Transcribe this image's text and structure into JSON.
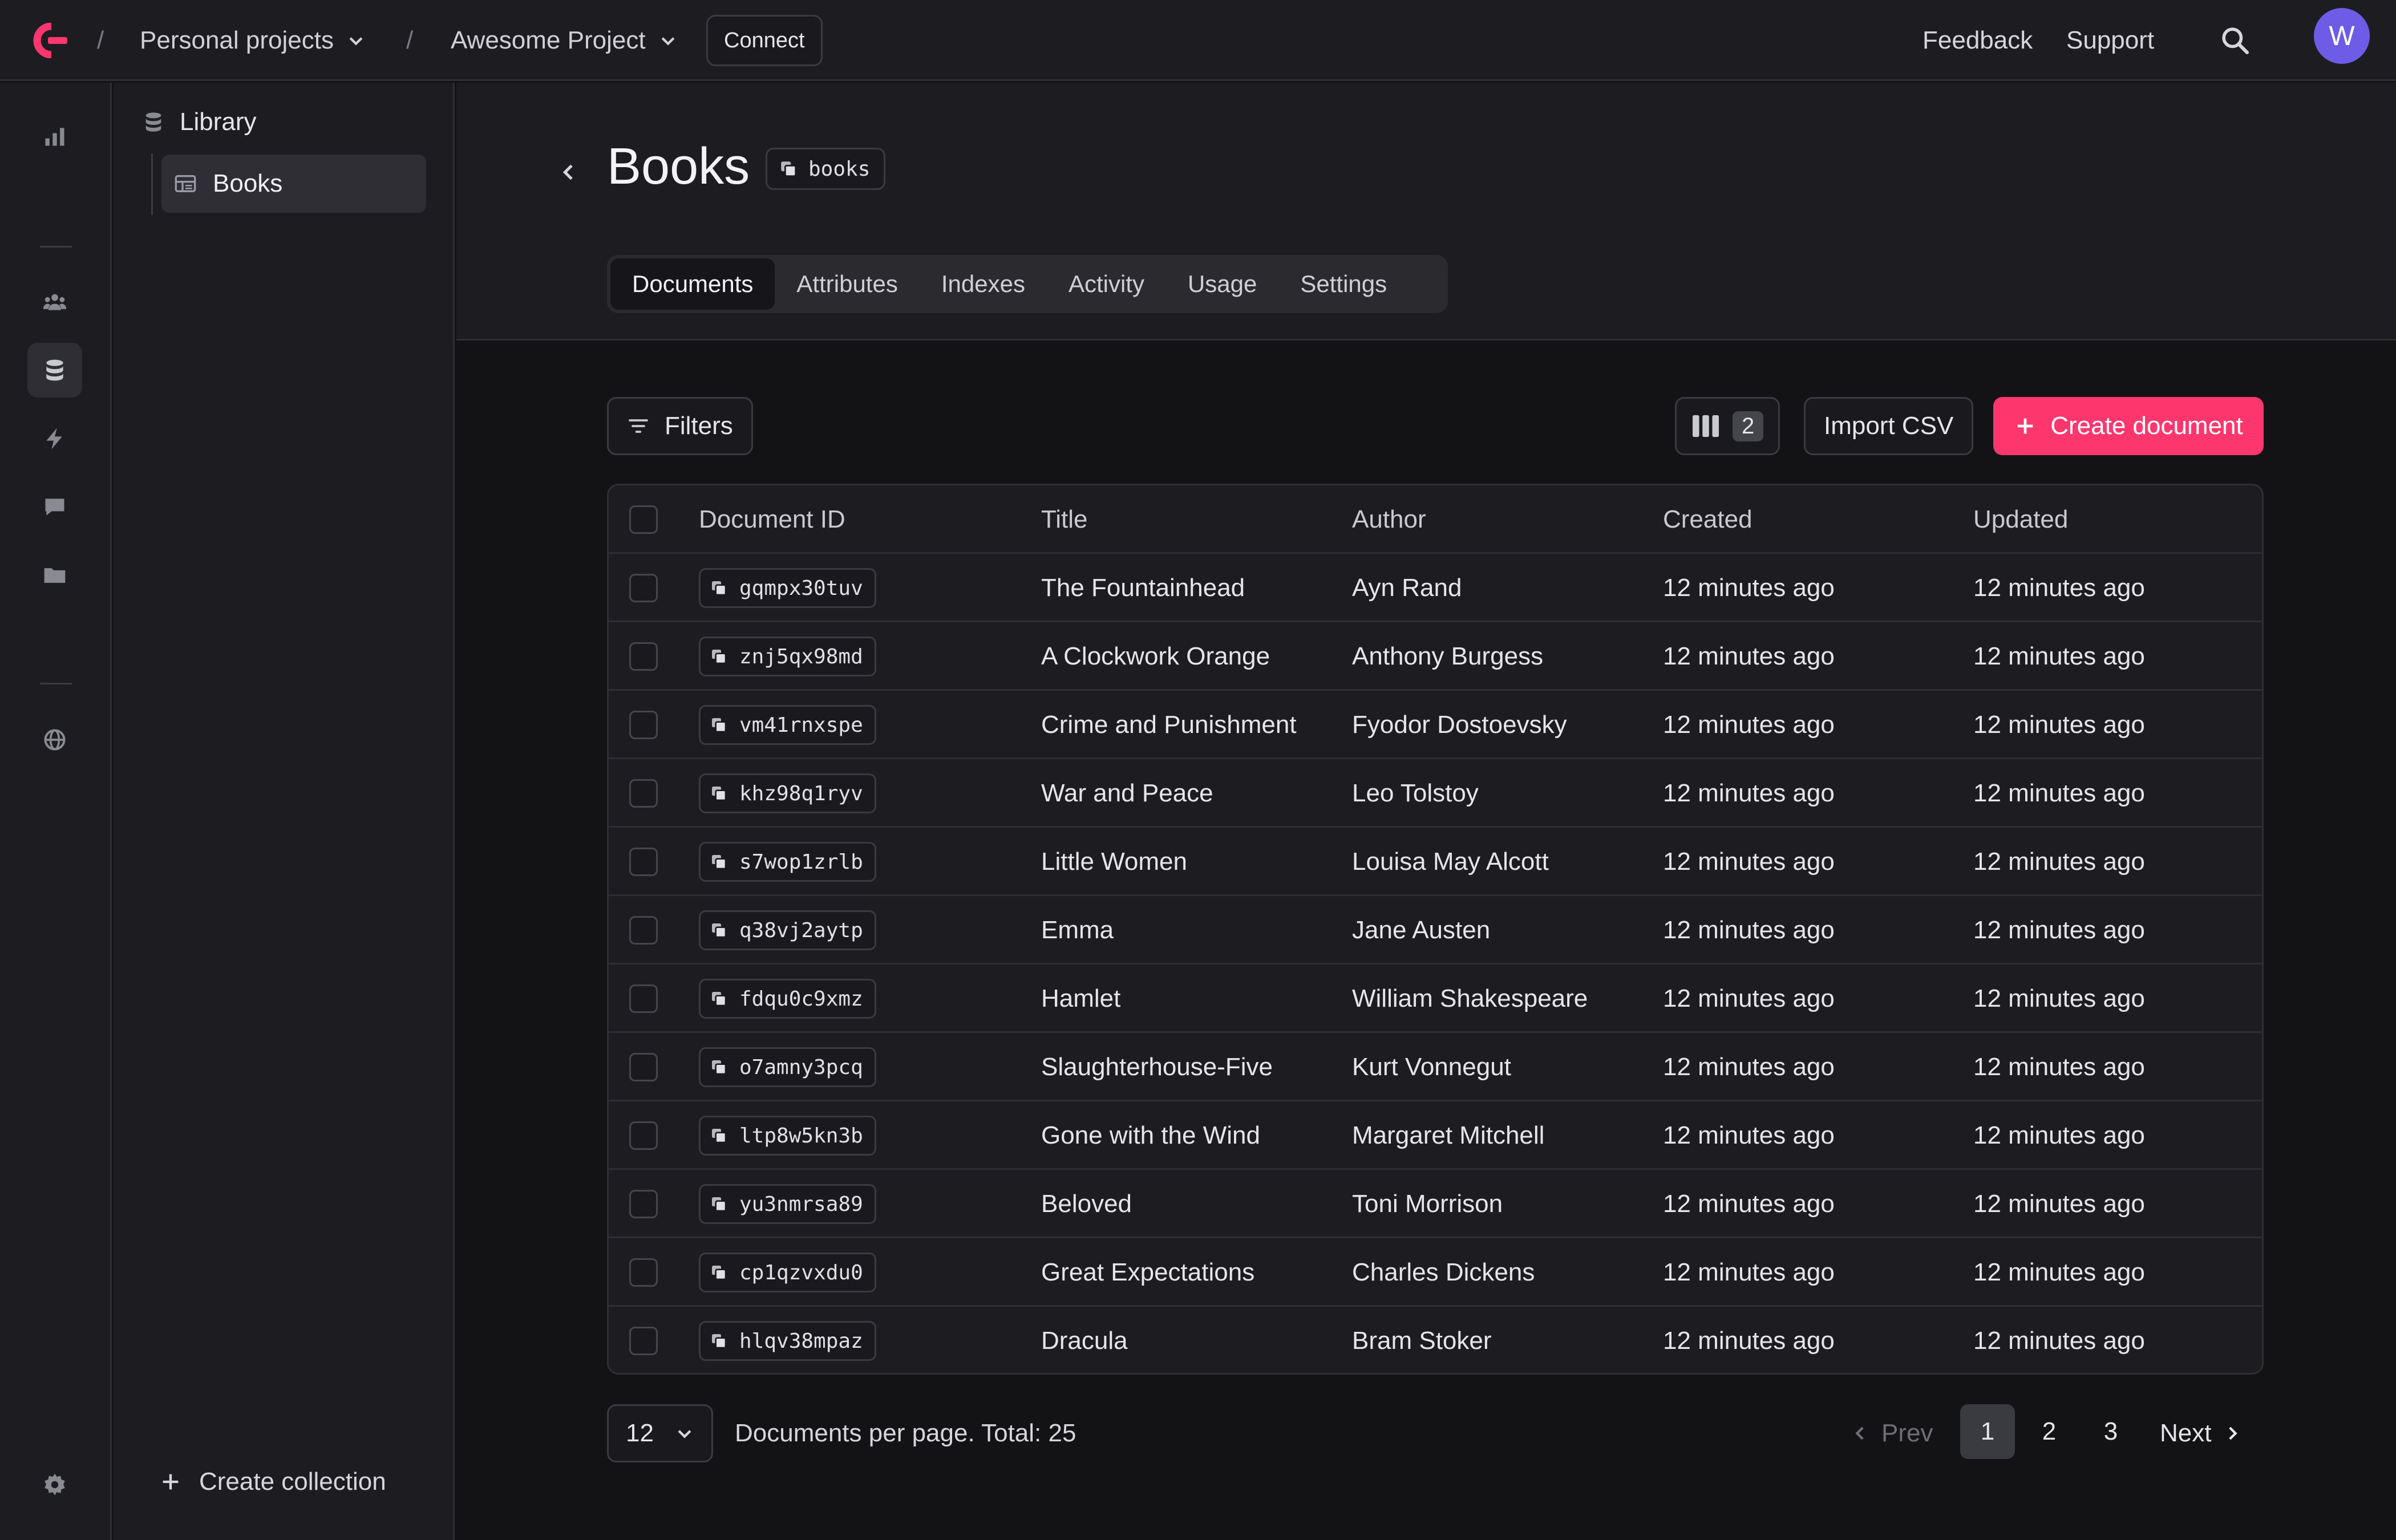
{
  "topbar": {
    "org": "Personal projects",
    "project": "Awesome Project",
    "connect_label": "Connect",
    "feedback_label": "Feedback",
    "support_label": "Support",
    "avatar_initial": "W",
    "breadcrumb_separator": "/"
  },
  "rail": {
    "icons": [
      "bar-chart-icon",
      "users-icon",
      "database-icon",
      "bolt-icon",
      "message-icon",
      "folder-icon",
      "globe-icon",
      "gear-icon"
    ],
    "active": "database-icon"
  },
  "sidebar": {
    "database_label": "Library",
    "collection_label": "Books",
    "create_collection_label": "Create collection"
  },
  "header": {
    "title": "Books",
    "collection_id": "books",
    "tabs": [
      {
        "label": "Documents",
        "active": true
      },
      {
        "label": "Attributes"
      },
      {
        "label": "Indexes"
      },
      {
        "label": "Activity"
      },
      {
        "label": "Usage"
      },
      {
        "label": "Settings"
      }
    ]
  },
  "toolbar": {
    "filters_label": "Filters",
    "columns_count": "2",
    "import_label": "Import CSV",
    "create_label": "Create document"
  },
  "table": {
    "columns": [
      "Document ID",
      "Title",
      "Author",
      "Created",
      "Updated"
    ],
    "rows": [
      {
        "id": "gqmpx30tuv",
        "title": "The Fountainhead",
        "author": "Ayn Rand",
        "created": "12 minutes ago",
        "updated": "12 minutes ago"
      },
      {
        "id": "znj5qx98md",
        "title": "A Clockwork Orange",
        "author": "Anthony Burgess",
        "created": "12 minutes ago",
        "updated": "12 minutes ago"
      },
      {
        "id": "vm41rnxspe",
        "title": "Crime and Punishment",
        "author": "Fyodor Dostoevsky",
        "created": "12 minutes ago",
        "updated": "12 minutes ago"
      },
      {
        "id": "khz98q1ryv",
        "title": "War and Peace",
        "author": "Leo Tolstoy",
        "created": "12 minutes ago",
        "updated": "12 minutes ago"
      },
      {
        "id": "s7wop1zrlb",
        "title": "Little Women",
        "author": "Louisa May Alcott",
        "created": "12 minutes ago",
        "updated": "12 minutes ago"
      },
      {
        "id": "q38vj2aytp",
        "title": "Emma",
        "author": "Jane Austen",
        "created": "12 minutes ago",
        "updated": "12 minutes ago"
      },
      {
        "id": "fdqu0c9xmz",
        "title": "Hamlet",
        "author": "William Shakespeare",
        "created": "12 minutes ago",
        "updated": "12 minutes ago"
      },
      {
        "id": "o7amny3pcq",
        "title": "Slaughterhouse-Five",
        "author": "Kurt Vonnegut",
        "created": "12 minutes ago",
        "updated": "12 minutes ago"
      },
      {
        "id": "ltp8w5kn3b",
        "title": "Gone with the Wind",
        "author": "Margaret Mitchell",
        "created": "12 minutes ago",
        "updated": "12 minutes ago"
      },
      {
        "id": "yu3nmrsa89",
        "title": "Beloved",
        "author": "Toni Morrison",
        "created": "12 minutes ago",
        "updated": "12 minutes ago"
      },
      {
        "id": "cp1qzvxdu0",
        "title": "Great Expectations",
        "author": "Charles Dickens",
        "created": "12 minutes ago",
        "updated": "12 minutes ago"
      },
      {
        "id": "hlqv38mpaz",
        "title": "Dracula",
        "author": "Bram Stoker",
        "created": "12 minutes ago",
        "updated": "12 minutes ago"
      }
    ]
  },
  "footer": {
    "per_page": "12",
    "per_page_text": "Documents per page. Total: 25",
    "prev_label": "Prev",
    "next_label": "Next",
    "pages": [
      "1",
      "2",
      "3"
    ],
    "current_page": "1"
  },
  "colors": {
    "accent": "#fd366e",
    "avatar": "#6e5ce6",
    "background": "#131316",
    "surface": "#1d1d21"
  }
}
